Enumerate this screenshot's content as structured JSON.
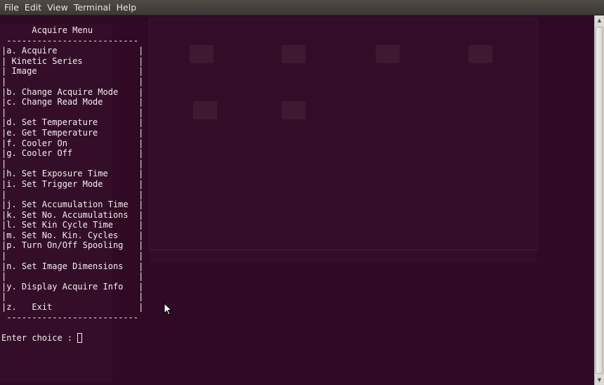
{
  "menubar": {
    "items": [
      "File",
      "Edit",
      "View",
      "Terminal",
      "Help"
    ]
  },
  "terminal": {
    "lines": [
      "      Acquire Menu",
      " --------------------------",
      "|a. Acquire                |",
      "| Kinetic Series           |",
      "| Image                    |",
      "|                          |",
      "|b. Change Acquire Mode    |",
      "|c. Change Read Mode       |",
      "|                          |",
      "|d. Set Temperature        |",
      "|e. Get Temperature        |",
      "|f. Cooler On              |",
      "|g. Cooler Off             |",
      "|                          |",
      "|h. Set Exposure Time      |",
      "|i. Set Trigger Mode       |",
      "|                          |",
      "|j. Set Accumulation Time  |",
      "|k. Set No. Accumulations  |",
      "|l. Set Kin Cycle Time     |",
      "|m. Set No. Kin. Cycles    |",
      "|p. Turn On/Off Spooling   |",
      "|                          |",
      "|n. Set Image Dimensions   |",
      "|                          |",
      "|y. Display Acquire Info   |",
      "|                          |",
      "|z.   Exit                 |",
      " --------------------------"
    ],
    "prompt": "Enter choice : "
  },
  "colors": {
    "terminal_background": "#300a24",
    "terminal_text": "#efefef",
    "menubar_background": "#3c3b37"
  }
}
